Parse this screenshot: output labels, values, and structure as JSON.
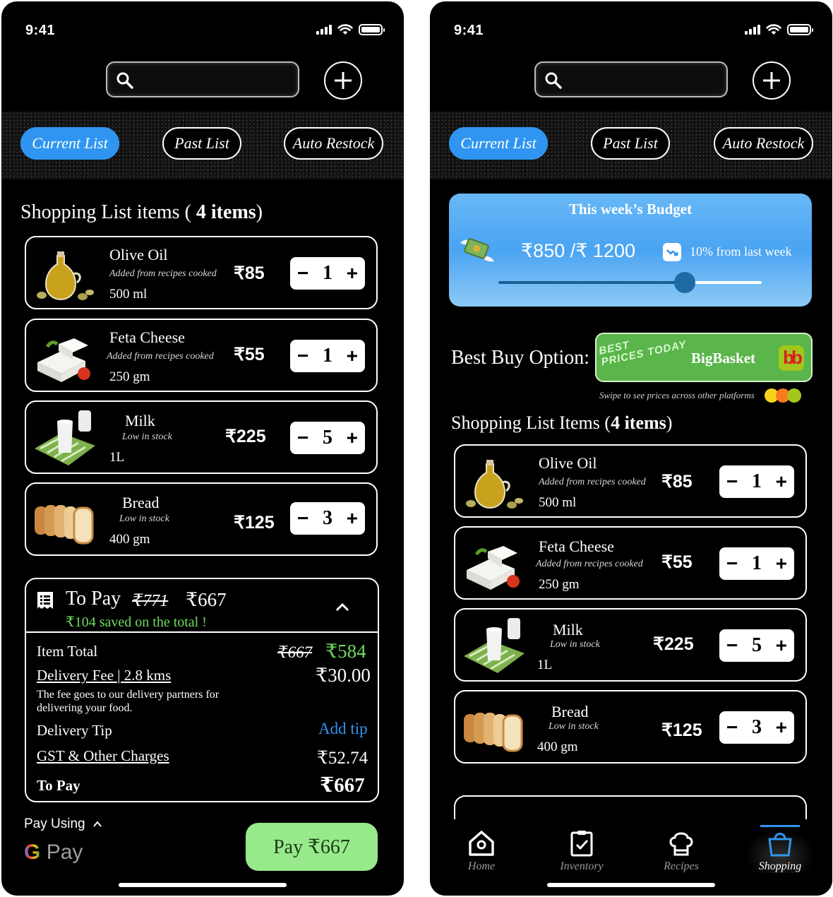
{
  "status": {
    "time": "9:41"
  },
  "tabs": [
    "Current List",
    "Past List",
    "Auto Restock"
  ],
  "left": {
    "heading_prefix": "Shopping List items (",
    "heading_count": "4 items",
    "heading_suffix": ")",
    "items": [
      {
        "name": "Olive Oil",
        "note": "Added from recipes cooked",
        "size": "500 ml",
        "price": "₹85",
        "qty": "1"
      },
      {
        "name": "Feta Cheese",
        "note": "Added from recipes cooked",
        "size": "250 gm",
        "price": "₹55",
        "qty": "1"
      },
      {
        "name": "Milk",
        "note": "Low in stock",
        "size": "1L",
        "price": "₹225",
        "qty": "5"
      },
      {
        "name": "Bread",
        "note": "Low in stock",
        "size": "400 gm",
        "price": "₹125",
        "qty": "3"
      }
    ],
    "to_pay": {
      "title": "To Pay",
      "original": "₹771",
      "final": "₹667",
      "saved": "₹104 saved on the total !",
      "item_total_label": "Item Total",
      "item_total_old": "₹667",
      "item_total_new": "₹584",
      "delivery_label": "Delivery Fee | 2.8 kms",
      "delivery_value": "₹30.00",
      "delivery_note": "The fee goes to our delivery partners for delivering your food.",
      "tip_label": "Delivery Tip",
      "tip_action": "Add tip",
      "gst_label": "GST & Other Charges",
      "gst_value": "₹52.74",
      "total_label": "To Pay",
      "total_value": "₹667"
    },
    "pay_using": "Pay Using",
    "gpay_g": "G",
    "gpay_pay": "Pay",
    "pay_button": "Pay ₹667"
  },
  "right": {
    "budget": {
      "title": "This week’s Budget",
      "amount": "₹850 /₹ 1200",
      "change": "10% from last week",
      "spent_fraction": 0.708
    },
    "best_label": "Best Buy Option:",
    "best_stamp_1": "BEST",
    "best_stamp_2": "PRICES TODAY",
    "best_platform": "BigBasket",
    "best_logo": "bb",
    "swipe_note": "Swipe to see prices across other platforms",
    "heading_prefix": "Shopping List Items (",
    "heading_count": "4 items",
    "heading_suffix": ")",
    "items": [
      {
        "name": "Olive Oil",
        "note": "Added from recipes cooked",
        "size": "500 ml",
        "price": "₹85",
        "qty": "1"
      },
      {
        "name": "Feta Cheese",
        "note": "Added from recipes cooked",
        "size": "250 gm",
        "price": "₹55",
        "qty": "1"
      },
      {
        "name": "Milk",
        "note": "Low in stock",
        "size": "1L",
        "price": "₹225",
        "qty": "5"
      },
      {
        "name": "Bread",
        "note": "Low in stock",
        "size": "400 gm",
        "price": "₹125",
        "qty": "3"
      }
    ],
    "nav": [
      "Home",
      "Inventory",
      "Recipes",
      "Shopping"
    ]
  },
  "colors": {
    "accent_blue": "#2f95f0",
    "pay_green": "#98e88c",
    "saved_green": "#6fdc5f",
    "link_blue": "#2f95f0"
  },
  "icons": [
    "search-icon",
    "plus-icon",
    "receipt-icon",
    "chevron-up-icon",
    "home-icon",
    "inventory-icon",
    "chef-hat-icon",
    "shopping-bag-icon",
    "trend-icon",
    "money-wings-icon"
  ]
}
